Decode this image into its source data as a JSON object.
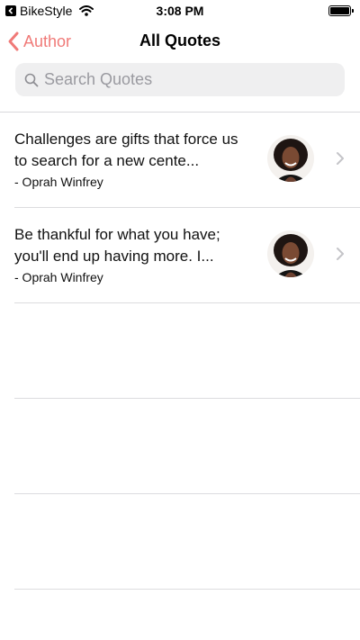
{
  "status_bar": {
    "carrier": "BikeStyle",
    "time": "3:08 PM",
    "battery_level": 1.0
  },
  "nav": {
    "back_label": "Author",
    "title": "All Quotes"
  },
  "search": {
    "placeholder": "Search Quotes",
    "value": ""
  },
  "quotes": [
    {
      "text": "Challenges are gifts that force us to search for a new cente...",
      "author": "- Oprah Winfrey"
    },
    {
      "text": "Be thankful for what you have; you'll end up having more. I...",
      "author": "- Oprah Winfrey"
    }
  ],
  "colors": {
    "accent": "#f07a78",
    "search_bg": "#efeff0",
    "divider": "#dcdcdf"
  }
}
